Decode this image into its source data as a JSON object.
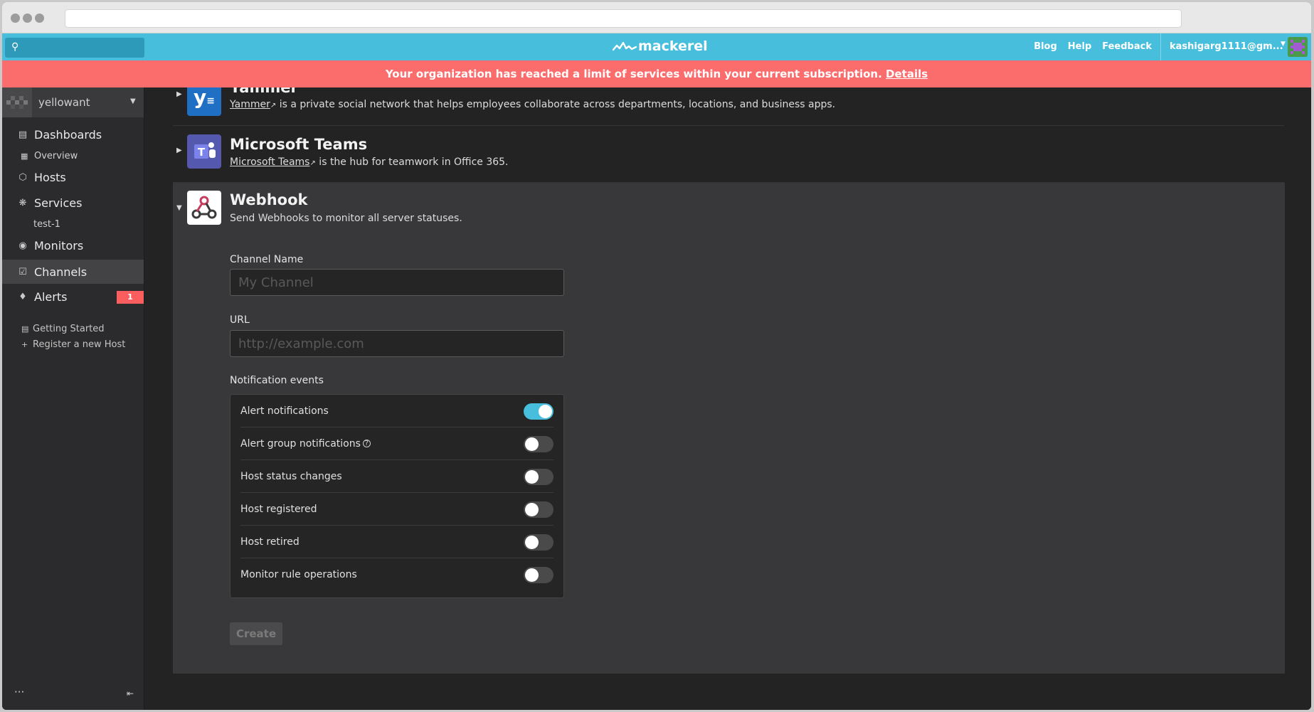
{
  "topnav": {
    "logo_text": "mackerel",
    "links": [
      "Blog",
      "Help",
      "Feedback"
    ],
    "user_email": "kashigarg1111@gm..."
  },
  "banner": {
    "message": "Your organization has reached a limit of services within your current subscription.",
    "link": "Details"
  },
  "sidebar": {
    "org_name": "yellowant",
    "items": {
      "dashboards": "Dashboards",
      "overview": "Overview",
      "hosts": "Hosts",
      "services": "Services",
      "test1": "test-1",
      "monitors": "Monitors",
      "channels": "Channels",
      "alerts": "Alerts",
      "alerts_count": "1"
    },
    "getting_started": "Getting Started",
    "register_host": "Register a new Host"
  },
  "channels": {
    "yammer": {
      "title": "Yammer",
      "link": "Yammer",
      "desc": " is a private social network that helps employees collaborate across departments, locations, and business apps."
    },
    "teams": {
      "title": "Microsoft Teams",
      "link": "Microsoft Teams",
      "desc": " is the hub for teamwork in Office 365."
    },
    "webhook": {
      "title": "Webhook",
      "desc": "Send Webhooks to monitor all server statuses.",
      "channel_name_label": "Channel Name",
      "channel_name_placeholder": "My Channel",
      "url_label": "URL",
      "url_placeholder": "http://example.com",
      "events_label": "Notification events",
      "events": [
        {
          "label": "Alert notifications",
          "on": true
        },
        {
          "label": "Alert group notifications",
          "on": false
        },
        {
          "label": "Host status changes",
          "on": false
        },
        {
          "label": "Host registered",
          "on": false
        },
        {
          "label": "Host retired",
          "on": false
        },
        {
          "label": "Monitor rule operations",
          "on": false
        }
      ],
      "create_label": "Create"
    }
  },
  "colors": {
    "accent": "#48bedd",
    "banner": "#fb6c6c",
    "yammer": "#1f6fc4",
    "teams": "#5558af"
  }
}
